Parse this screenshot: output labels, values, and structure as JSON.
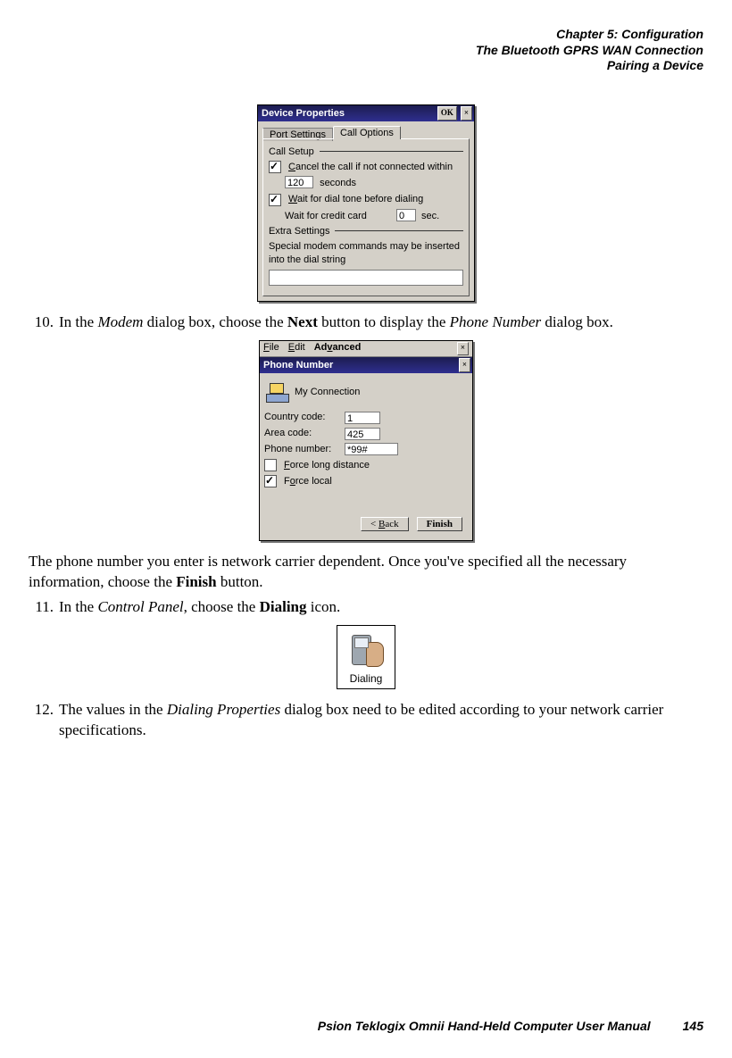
{
  "header": {
    "chapter": "Chapter 5: Configuration",
    "section": "The Bluetooth GPRS WAN Connection",
    "subsection": "Pairing a Device"
  },
  "dialog1": {
    "title": "Device Properties",
    "ok_label": "OK",
    "close_label": "×",
    "tabs": {
      "port": "Port Settings",
      "call": "Call Options"
    },
    "group_setup": "Call Setup",
    "cancel_label": "Cancel the call if not connected within",
    "seconds_value": "120",
    "seconds_label": "seconds",
    "wait_dial": "Wait for dial tone before dialing",
    "wait_credit": "Wait for credit card",
    "credit_value": "0",
    "credit_unit": "sec.",
    "group_extra": "Extra Settings",
    "extra_hint": "Special modem commands may be inserted into the dial string",
    "extra_value": ""
  },
  "step10_num": "10.",
  "step10_a": "In the ",
  "step10_b": "Modem",
  "step10_c": " dialog box, choose the ",
  "step10_d": "Next",
  "step10_e": " button to display the ",
  "step10_f": "Phone Number",
  "step10_g": " dialog box.",
  "dialog2": {
    "menu": {
      "file": "File",
      "edit": "Edit",
      "adv": "Advanced"
    },
    "title": "Phone Number",
    "conn_name": "My Connection",
    "country_label": "Country code:",
    "country_value": "1",
    "area_label": "Area code:",
    "area_value": "425",
    "phone_label": "Phone number:",
    "phone_value": "*99#",
    "force_long": "Force long distance",
    "force_local": "Force local",
    "back_label": "< Back",
    "finish_label": "Finish",
    "close": "×"
  },
  "mid_a": "The phone number you enter is network carrier dependent. Once you've specified all the necessary information, choose the ",
  "mid_b": "Finish",
  "mid_c": " button.",
  "step11_num": "11.",
  "step11_a": "In the ",
  "step11_b": "Control Panel",
  "step11_c": ", choose the ",
  "step11_d": "Dialing",
  "step11_e": " icon.",
  "dialing_label": "Dialing",
  "step12_num": "12.",
  "step12_a": "The values in the ",
  "step12_b": "Dialing Properties",
  "step12_c": " dialog box need to be edited according to your network carrier specifications.",
  "footer": {
    "text": "Psion Teklogix Omnii Hand-Held Computer User Manual",
    "page": "145"
  }
}
